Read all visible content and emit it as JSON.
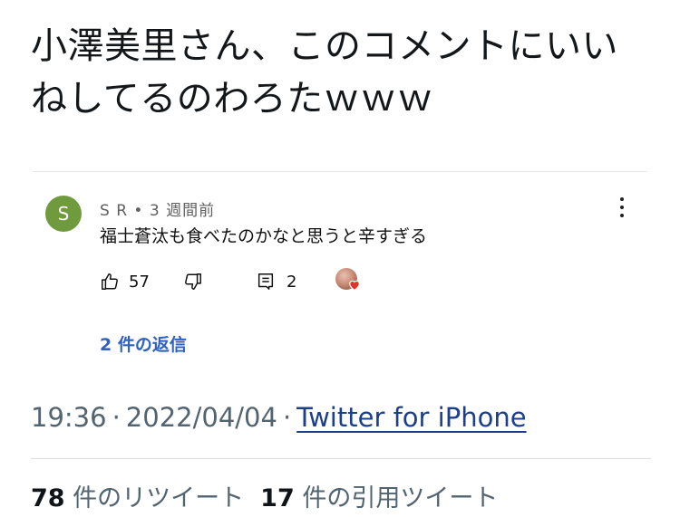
{
  "tweet": {
    "text_line1": "小澤美里さん、このコメントにいい",
    "text_line2": "ねしてるのわろたｗｗｗ"
  },
  "comment": {
    "avatar_letter": "S",
    "author": "S R",
    "time_ago": "3 週間前",
    "body": "福士蒼汰も食べたのかなと思うと辛すぎる",
    "like_count": "57",
    "reply_count": "2",
    "replies_link": "2 件の返信",
    "icons": {
      "like": "thumbs-up-icon",
      "dislike": "thumbs-down-icon",
      "reply": "comment-icon",
      "menu": "more-vert-icon",
      "heart": "heart-icon"
    },
    "colors": {
      "avatar_bg": "#6f9a3e",
      "replies_link": "#2f62c0",
      "heart": "#e0332b"
    }
  },
  "timestamp": {
    "time": "19:36",
    "date": "2022/04/04",
    "source": "Twitter for iPhone"
  },
  "stats": {
    "retweets_count": "78",
    "retweets_label": "件のリツイート",
    "quotes_count": "17",
    "quotes_label": "件の引用ツイート"
  }
}
